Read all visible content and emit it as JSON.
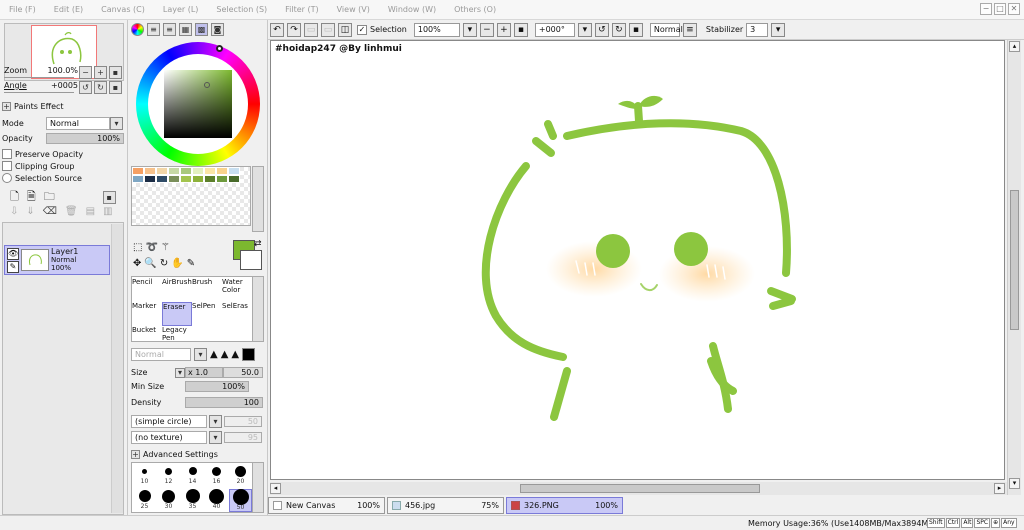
{
  "menu": [
    "File (F)",
    "Edit (E)",
    "Canvas (C)",
    "Layer (L)",
    "Selection (S)",
    "Filter (T)",
    "View (V)",
    "Window (W)",
    "Others (O)"
  ],
  "window": {
    "minimize": "−",
    "restore": "□",
    "close": "✕"
  },
  "nav": {
    "zoom_label": "Zoom",
    "zoom_value": "100.0%",
    "angle_label": "Angle",
    "angle_value": "+0005"
  },
  "layer_panel": {
    "paints_effect": "Paints Effect",
    "mode_label": "Mode",
    "mode_value": "Normal",
    "opacity_label": "Opacity",
    "opacity_value": "100%",
    "preserve_opacity": "Preserve Opacity",
    "clipping_group": "Clipping Group",
    "selection_source": "Selection Source"
  },
  "layer": {
    "name": "Layer1",
    "mode": "Normal",
    "opacity": "100%"
  },
  "tools": [
    {
      "label": "Pencil"
    },
    {
      "label": "AirBrush"
    },
    {
      "label": "Brush"
    },
    {
      "label": "Water Color"
    },
    {
      "label": "Marker"
    },
    {
      "label": "Eraser"
    },
    {
      "label": "SelPen"
    },
    {
      "label": "SelEras"
    },
    {
      "label": "Bucket"
    },
    {
      "label": "Legacy Pen"
    }
  ],
  "brush": {
    "blend": "Normal",
    "size_label": "Size",
    "size_mult": "x 1.0",
    "size_value": "50.0",
    "minsize_label": "Min Size",
    "minsize_value": "100%",
    "density_label": "Density",
    "density_value": "100",
    "shape": "(simple circle)",
    "shape_value": "50",
    "texture": "(no texture)",
    "texture_value": "95",
    "advanced": "Advanced Settings"
  },
  "brush_sizes": [
    "10",
    "12",
    "14",
    "16",
    "20",
    "25",
    "30",
    "35",
    "40",
    "50"
  ],
  "toolbar": {
    "selection_label": "Selection",
    "zoom": "100%",
    "angle": "+000°",
    "blend": "Normal",
    "stabilizer_label": "Stabilizer",
    "stabilizer_value": "3"
  },
  "canvas": {
    "watermark": "#hoidap247 @By linhmui"
  },
  "tabs": [
    {
      "name": "New Canvas",
      "zoom": "100%"
    },
    {
      "name": "456.jpg",
      "zoom": "75%"
    },
    {
      "name": "326.PNG",
      "zoom": "100%"
    }
  ],
  "status": {
    "memory": "Memory Usage:36% (Use1408MB/Max3894MB)",
    "keys": [
      "Shift",
      "Ctrl",
      "Alt",
      "SPC",
      "⊕",
      "Any"
    ]
  },
  "colors": {
    "primary": "#7cb82f",
    "secondary": "#ffffff",
    "accent": "#c9c9f6"
  },
  "palette": [
    "#f5a064",
    "#f7c28c",
    "#f2d6a8",
    "#c7d9a6",
    "#a9c97c",
    "#e3f0c0",
    "#fbe6a5",
    "#f8d38d",
    "#c8dff0",
    "#7fa7c4",
    "#1c2d45",
    "#2f4b66",
    "#7a8f5a",
    "#a3c44e",
    "#8db13a",
    "#5c7f2a",
    "#6e9a3d",
    "#496b2b"
  ]
}
